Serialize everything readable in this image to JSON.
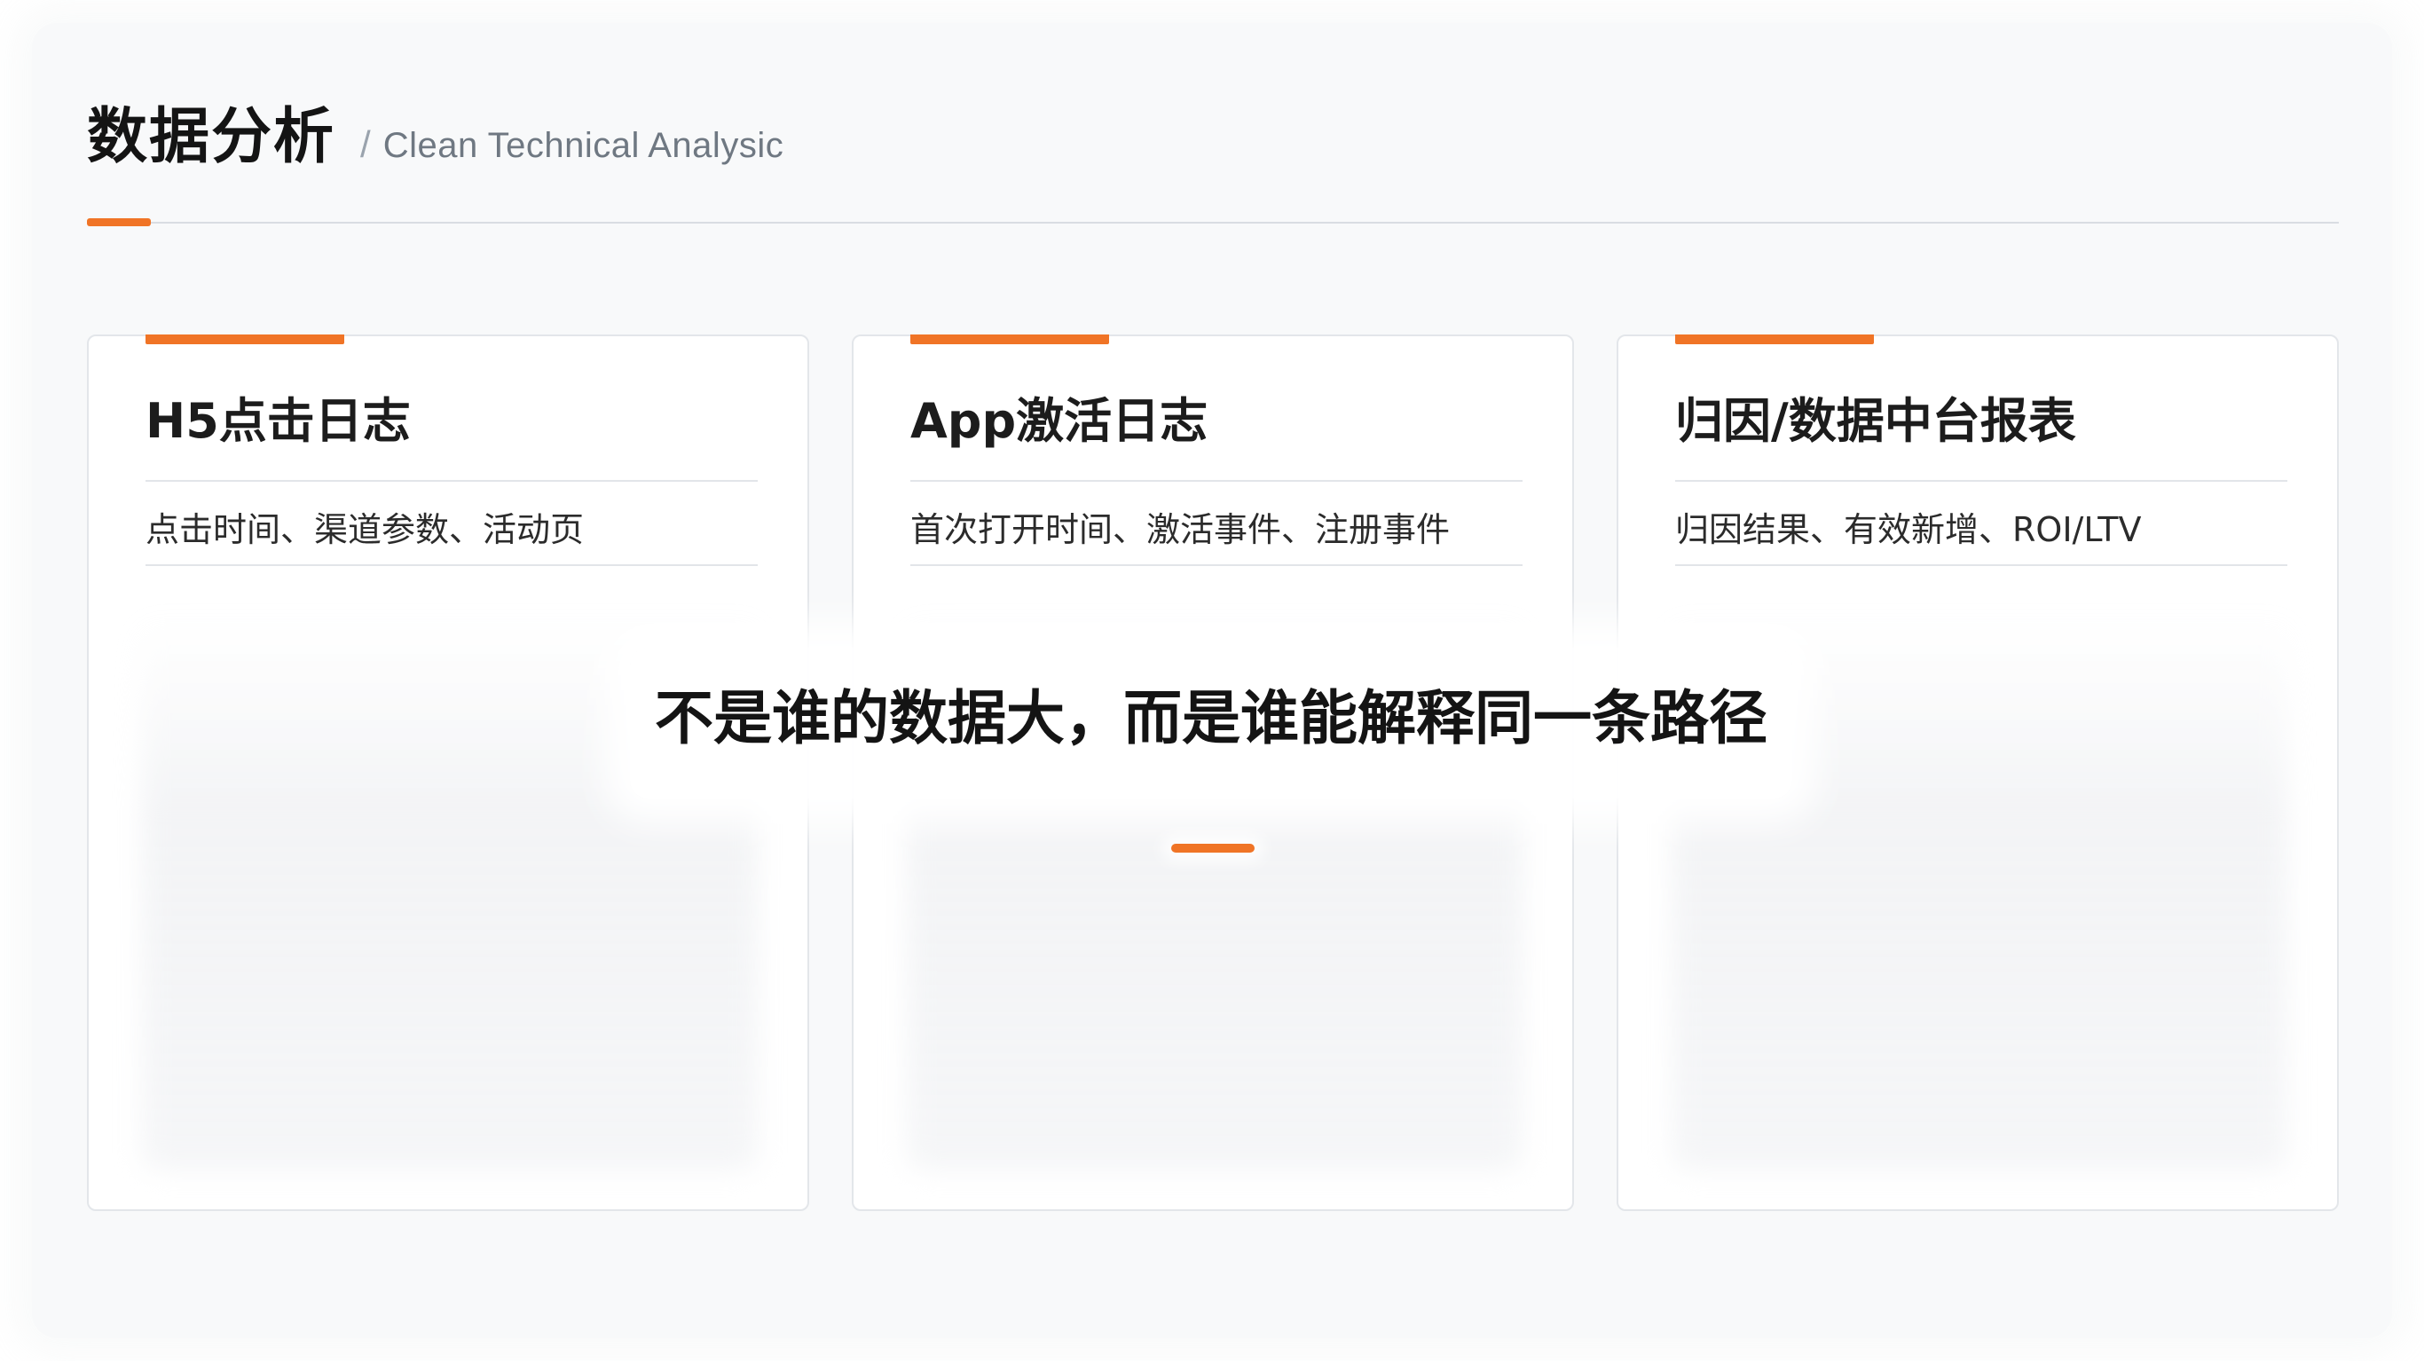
{
  "header": {
    "title": "数据分析",
    "separator": "/",
    "subtitle": "Clean Technical Analysic"
  },
  "cards": [
    {
      "title": "H5点击日志",
      "description": "点击时间、渠道参数、活动页"
    },
    {
      "title": "App激活日志",
      "description": "首次打开时间、激活事件、注册事件"
    },
    {
      "title": "归因/数据中台报表",
      "description": "归因结果、有效新增、ROI/LTV"
    }
  ],
  "caption": {
    "text": "不是谁的数据大，而是谁能解释同一条路径"
  },
  "colors": {
    "accent": "#f07426",
    "background": "#f8f9fa",
    "card_border": "#e3e6ea",
    "rule": "#d9dde2"
  }
}
